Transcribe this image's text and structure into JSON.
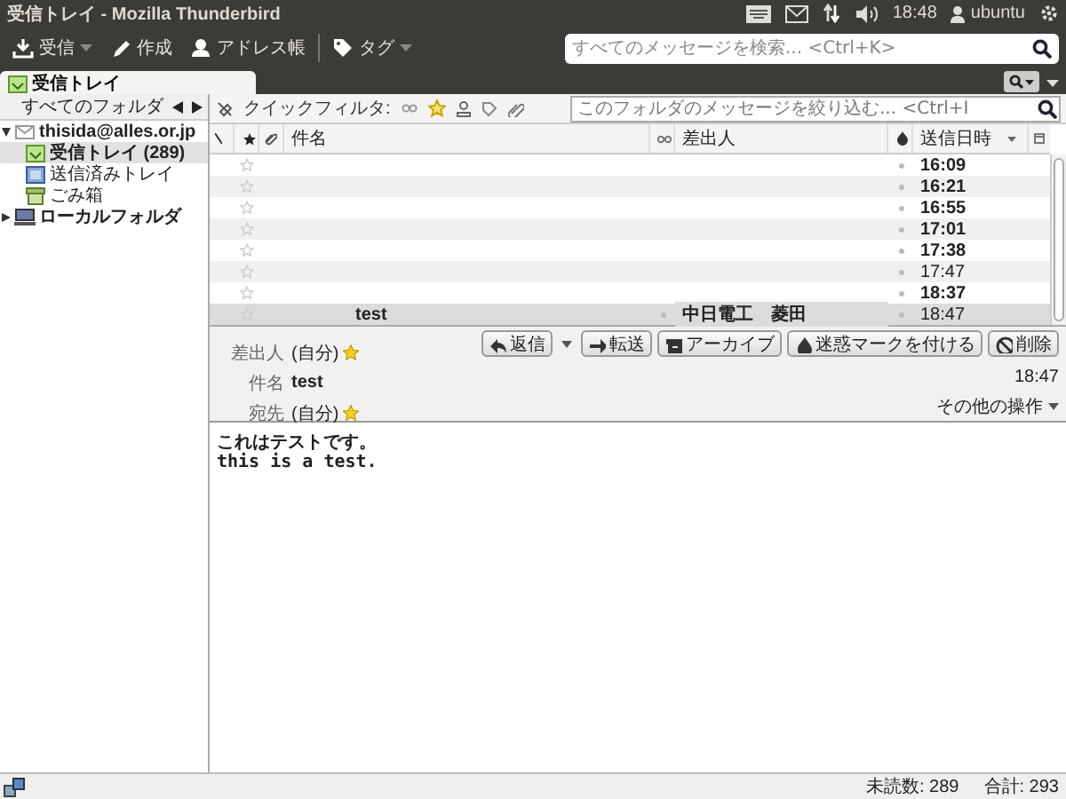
{
  "window": {
    "title": "受信トレイ - Mozilla Thunderbird"
  },
  "panel": {
    "clock": "18:48",
    "user": "ubuntu"
  },
  "toolbar": {
    "buttons": [
      {
        "label": "受信",
        "kind": "download",
        "menu": true
      },
      {
        "label": "作成",
        "kind": "pencil",
        "menu": false
      },
      {
        "label": "アドレス帳",
        "kind": "person",
        "menu": false
      },
      {
        "label": "タグ",
        "kind": "tag",
        "menu": true
      }
    ],
    "search": {
      "placeholder": "すべてのメッセージを検索... <Ctrl+K>"
    }
  },
  "tabs": [
    {
      "label": "受信トレイ",
      "selected": true
    }
  ],
  "folder_pane": {
    "header": "すべてのフォルダ",
    "tree": [
      {
        "label": "thisida@alles.or.jp",
        "kind": "account",
        "expanded": true,
        "selected": false,
        "unread": true,
        "children": [
          {
            "label": "受信トレイ (289)",
            "kind": "inbox",
            "selected": true,
            "unread": true
          },
          {
            "label": "送信済みトレイ",
            "kind": "sent",
            "selected": false,
            "unread": false
          },
          {
            "label": "ごみ箱",
            "kind": "trash",
            "selected": false,
            "unread": false
          }
        ]
      },
      {
        "label": "ローカルフォルダ",
        "kind": "local",
        "expanded": false,
        "selected": false,
        "unread": true
      }
    ]
  },
  "quick_filter": {
    "label": "クイックフィルタ:",
    "placeholder": "このフォルダのメッセージを絞り込む... <Ctrl+I"
  },
  "message_list": {
    "columns": [
      {
        "kind": "thread"
      },
      {
        "kind": "star"
      },
      {
        "kind": "attachment"
      },
      {
        "kind": "text",
        "label": "件名",
        "sorted": false
      },
      {
        "kind": "read"
      },
      {
        "kind": "text",
        "label": "差出人",
        "sorted": false
      },
      {
        "kind": "junk"
      },
      {
        "kind": "text",
        "label": "送信日時",
        "sorted": true
      }
    ],
    "rows": [
      {
        "date": "16:09",
        "unread": true,
        "starred": false,
        "selected": false
      },
      {
        "date": "16:21",
        "unread": true,
        "starred": false,
        "selected": false
      },
      {
        "date": "16:55",
        "unread": true,
        "starred": false,
        "selected": false
      },
      {
        "date": "17:01",
        "unread": true,
        "starred": false,
        "selected": false
      },
      {
        "date": "17:38",
        "unread": true,
        "starred": false,
        "selected": false
      },
      {
        "date": "17:47",
        "unread": false,
        "starred": false,
        "selected": false
      },
      {
        "date": "18:37",
        "unread": true,
        "starred": false,
        "selected": false
      },
      {
        "subject": "test",
        "sender": "中日電工　菱田",
        "date": "18:47",
        "unread": false,
        "starred": false,
        "selected": true
      }
    ]
  },
  "message_header": {
    "buttons": [
      {
        "label": "返信",
        "kind": "reply",
        "menu": true
      },
      {
        "label": "転送",
        "kind": "forward",
        "menu": false
      },
      {
        "label": "アーカイブ",
        "kind": "archive",
        "menu": false
      },
      {
        "label": "迷惑マークを付ける",
        "kind": "junk",
        "menu": false
      },
      {
        "label": "削除",
        "kind": "delete",
        "menu": false
      }
    ],
    "fields": [
      {
        "label": "差出人",
        "value": "(自分)",
        "kind": "address"
      },
      {
        "label": "件名",
        "value": "test",
        "kind": "subject"
      },
      {
        "label": "宛先",
        "value": "(自分)",
        "kind": "address"
      }
    ],
    "date": "18:47",
    "other_actions": "その他の操作"
  },
  "body": {
    "lines": [
      "これはテストです。",
      "this is a test."
    ]
  },
  "status_bar": {
    "unread": "未読数: 289",
    "total": "合計: 293"
  }
}
